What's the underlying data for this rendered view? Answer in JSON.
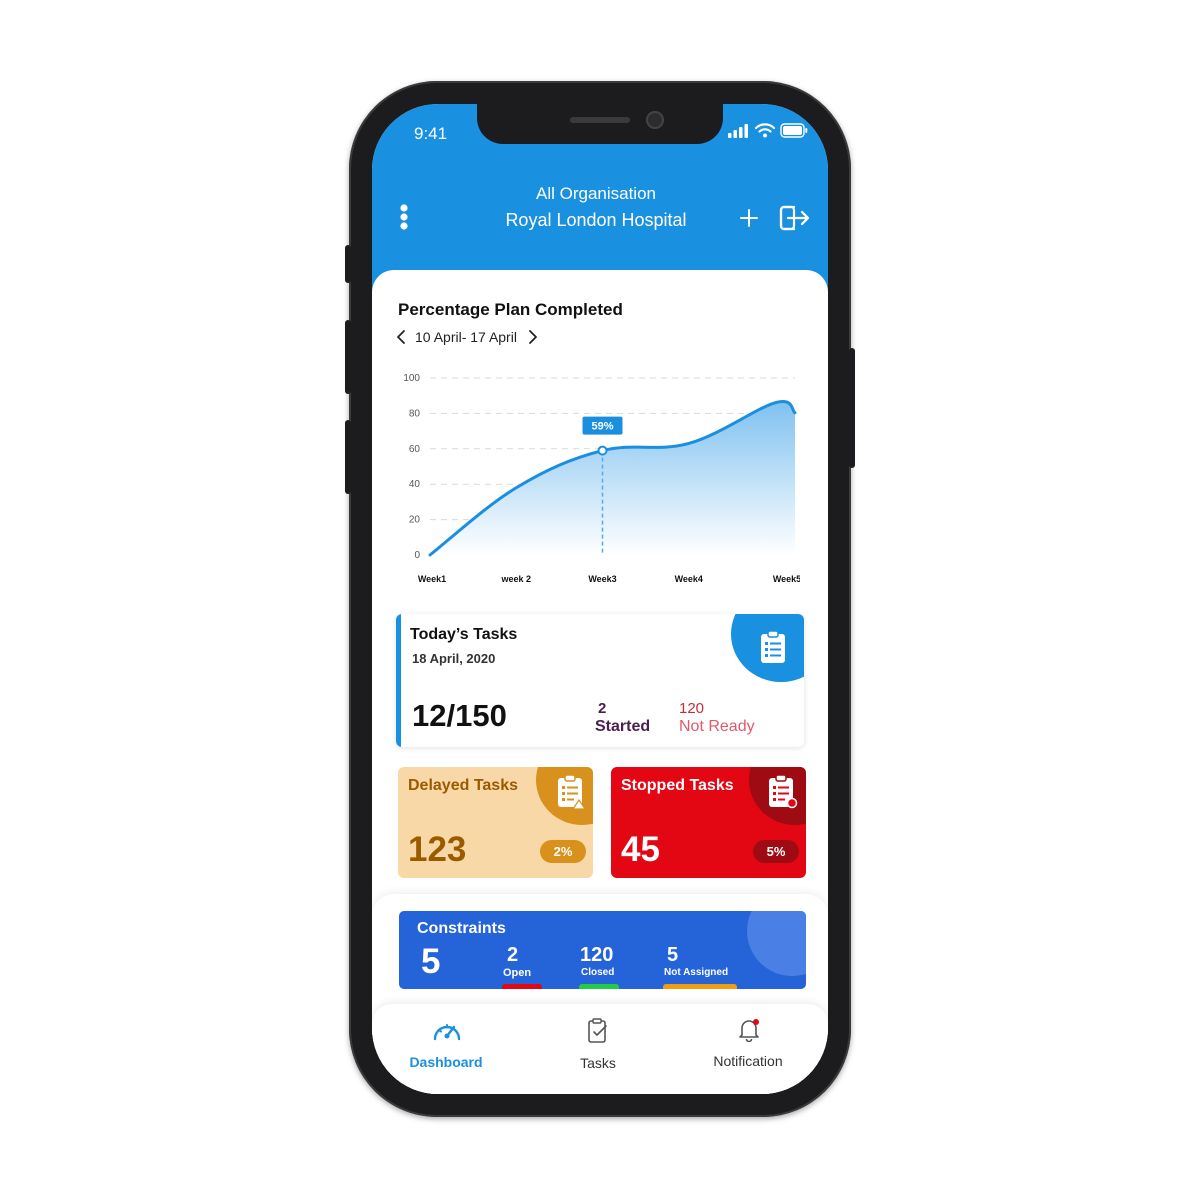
{
  "status_bar": {
    "time": "9:41"
  },
  "header": {
    "org_label": "All Organisation",
    "hospital": "Royal London Hospital"
  },
  "chart_section": {
    "title": "Percentage Plan Completed",
    "date_range": "10 April- 17 April"
  },
  "chart_data": {
    "type": "area",
    "categories": [
      "Week1",
      "week 2",
      "Week3",
      "Week4",
      "Week5"
    ],
    "y_ticks": [
      "100",
      "80",
      "60",
      "40",
      "20",
      "0"
    ],
    "ylim": [
      0,
      100
    ],
    "values": [
      0,
      38,
      59,
      63,
      86
    ],
    "highlight_label": "59%",
    "grid": true,
    "colors": {
      "line": "#1a8fdf",
      "fill_top": "#7fc1f0",
      "fill_bottom": "#ffffff"
    }
  },
  "todays_tasks": {
    "title": "Today’s Tasks",
    "date": "18 April, 2020",
    "count": "12/150",
    "started_value": "2",
    "started_label": "Started",
    "not_ready_value": "120",
    "not_ready_label": "Not Ready"
  },
  "delayed": {
    "title": "Delayed Tasks",
    "value": "123",
    "percent": "2%"
  },
  "stopped": {
    "title": "Stopped Tasks",
    "value": "45",
    "percent": "5%"
  },
  "constraints": {
    "title": "Constraints",
    "total": "5",
    "open_value": "2",
    "open_label": "Open",
    "closed_value": "120",
    "closed_label": "Closed",
    "not_assigned_value": "5",
    "not_assigned_label": "Not Assigned"
  },
  "nav": {
    "dashboard": "Dashboard",
    "tasks": "Tasks",
    "notification": "Notification"
  },
  "colors": {
    "primary": "#1a90e0",
    "delayed_bg": "#f9d8a8",
    "delayed_accent": "#d8911c",
    "stopped_bg": "#e30613",
    "stopped_accent": "#9e0b12",
    "constraints_bg": "#2563d8"
  }
}
